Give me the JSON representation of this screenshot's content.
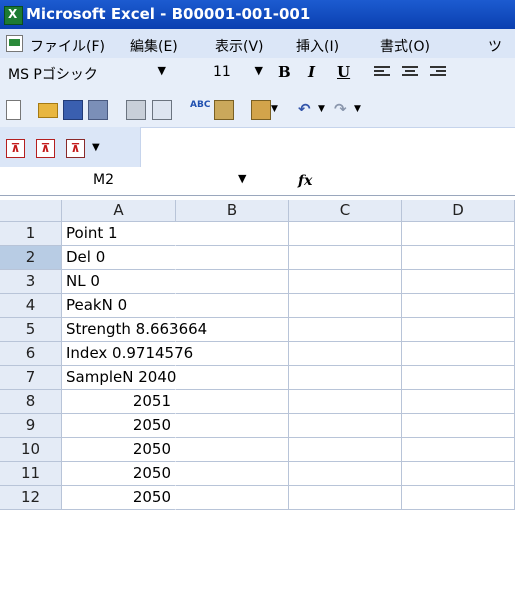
{
  "window": {
    "title": "Microsoft Excel - B00001-001-001"
  },
  "menu": [
    "ファイル(F)",
    "編集(E)",
    "表示(V)",
    "挿入(I)",
    "書式(O)",
    "ツ"
  ],
  "format": {
    "font_name": "MS Pゴシック",
    "font_size": "11",
    "bold": "B",
    "italic": "I",
    "underline": "U"
  },
  "formula_bar": {
    "cell_ref": "M2",
    "fx_label": "fx",
    "content": ""
  },
  "grid": {
    "columns": [
      "A",
      "B",
      "C",
      "D"
    ],
    "rows": [
      {
        "num": "1",
        "a": "Point 1",
        "align": "left"
      },
      {
        "num": "2",
        "a": "Del 0",
        "align": "left",
        "selected": true
      },
      {
        "num": "3",
        "a": "NL 0",
        "align": "left"
      },
      {
        "num": "4",
        "a": "PeakN 0",
        "align": "left"
      },
      {
        "num": "5",
        "a": "Strength 8.663664",
        "align": "left"
      },
      {
        "num": "6",
        "a": "Index 0.9714576",
        "align": "left"
      },
      {
        "num": "7",
        "a": "SampleN 2040",
        "align": "left"
      },
      {
        "num": "8",
        "a": "2051",
        "align": "right"
      },
      {
        "num": "9",
        "a": "2050",
        "align": "right"
      },
      {
        "num": "10",
        "a": "2050",
        "align": "right"
      },
      {
        "num": "11",
        "a": "2050",
        "align": "right"
      },
      {
        "num": "12",
        "a": "2050",
        "align": "right"
      }
    ]
  }
}
